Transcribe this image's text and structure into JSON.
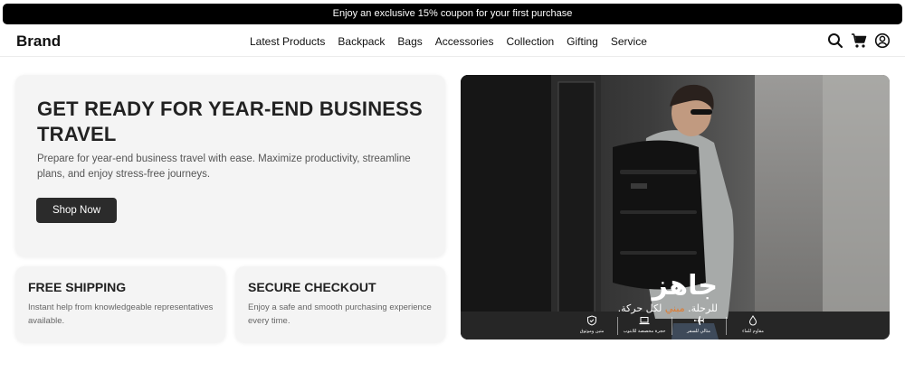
{
  "announcement": {
    "text": "Enjoy an exclusive 15% coupon for your first purchase"
  },
  "header": {
    "brand": "Brand",
    "nav": [
      {
        "label": "Latest Products"
      },
      {
        "label": "Backpack"
      },
      {
        "label": "Bags"
      },
      {
        "label": "Accessories"
      },
      {
        "label": "Collection"
      },
      {
        "label": "Gifting"
      },
      {
        "label": "Service"
      }
    ],
    "icons": [
      "search-icon",
      "cart-icon",
      "account-icon"
    ]
  },
  "hero": {
    "title": "GET READY FOR YEAR-END BUSINESS TRAVEL",
    "description": "Prepare for year-end business travel with ease. Maximize productivity, streamline plans, and enjoy stress-free journeys.",
    "button_label": "Shop Now"
  },
  "features": [
    {
      "title": "FREE SHIPPING",
      "description": "Instant help from knowledgeable representatives available."
    },
    {
      "title": "SECURE CHECKOUT",
      "description": "Enjoy a safe and smooth purchasing experience every time."
    }
  ],
  "banner": {
    "title": "جاهز",
    "subtitle_prefix": "للرحلة. ",
    "subtitle_accent": "مبني",
    "subtitle_suffix": " لكل حركة.",
    "accent_color": "#e07a2e",
    "features": [
      {
        "label": "متين وموثوق",
        "icon": "shield-icon"
      },
      {
        "label": "حجرة مخصصة للابتوب",
        "icon": "laptop-icon"
      },
      {
        "label": "مثالي للسفر",
        "icon": "plane-icon"
      },
      {
        "label": "مقاوم للماء",
        "icon": "water-drop-icon"
      }
    ]
  },
  "colors": {
    "announcement_bg": "#000000",
    "button_bg": "#2b2b2b",
    "card_bg": "#f4f4f4"
  }
}
